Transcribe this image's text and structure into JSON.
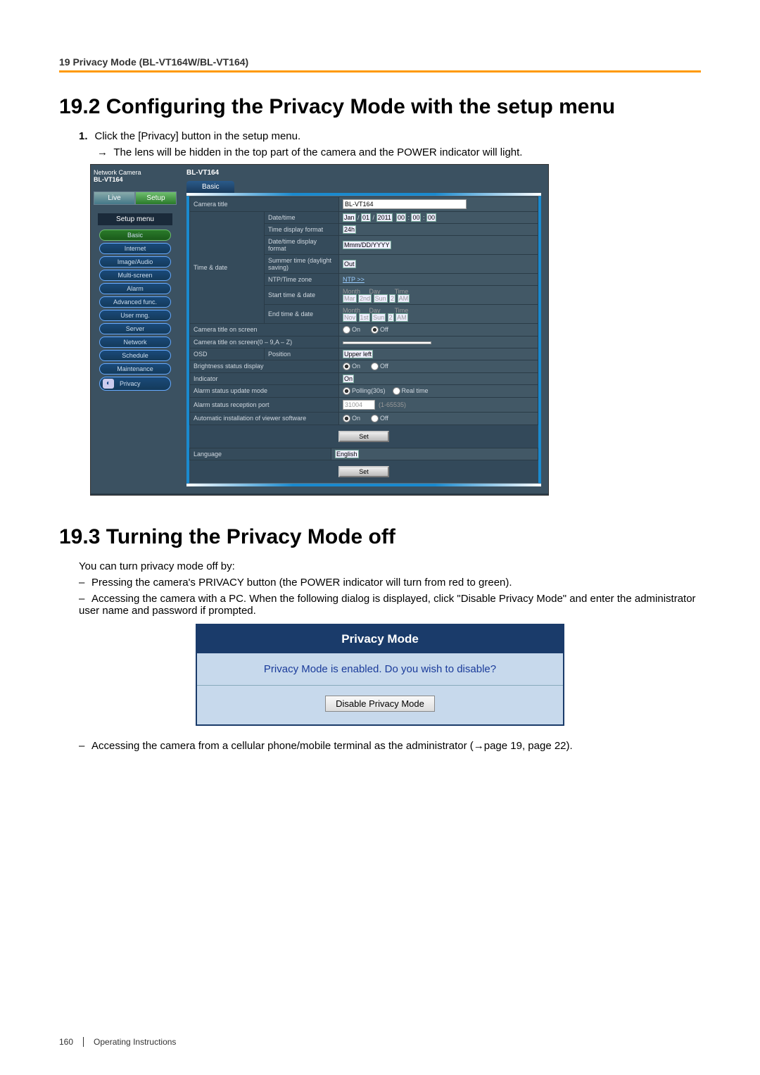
{
  "header": {
    "section": "19 Privacy Mode (BL-VT164W/BL-VT164)"
  },
  "h1_a": "19.2  Configuring the Privacy Mode with the setup menu",
  "step1_num": "1.",
  "step1_text": "Click the [Privacy] button in the setup menu.",
  "step1_sub": "The lens will be hidden in the top part of the camera and the POWER indicator will light.",
  "arrow": "→",
  "ss": {
    "top_left_a": "Network Camera",
    "top_left_b": "BL-VT164",
    "top_right": "BL-VT164",
    "tab_live": "Live",
    "tab_setup": "Setup",
    "menu_title": "Setup menu",
    "menu": [
      "Basic",
      "Internet",
      "Image/Audio",
      "Multi-screen",
      "Alarm",
      "Advanced func.",
      "User mng.",
      "Server",
      "Network",
      "Schedule",
      "Maintenance"
    ],
    "privacy": "Privacy",
    "panel_tab": "Basic",
    "rows": {
      "camera_title_lbl": "Camera title",
      "camera_title_val": "BL-VT164",
      "time_date_lbl": "Time & date",
      "dt_lbl": "Date/time",
      "dt_vals": {
        "mon": "Jan",
        "d": "01",
        "y": "2011",
        "h": "00",
        "m": "00",
        "s": "00"
      },
      "tdf_lbl": "Time display format",
      "tdf_val": "24h",
      "dtd_lbl": "Date/time display format",
      "dtd_val": "Mmm/DD/YYYY",
      "st_lbl": "Summer time (daylight saving)",
      "st_val": "Out",
      "ntp_lbl": "NTP/Time zone",
      "ntp_val": "NTP >>",
      "start_lbl": "Start time & date",
      "end_lbl": "End time & date",
      "mdt_month": "Month",
      "mdt_day": "Day",
      "mdt_time": "Time",
      "s_mon": "Mar",
      "s_wk": "2nd",
      "s_dow": "Sun",
      "s_h": "2",
      "s_ap": "AM",
      "e_mon": "Nov",
      "e_wk": "1st",
      "e_dow": "Sun",
      "e_h": "2",
      "e_ap": "AM",
      "ctos_lbl": "Camera title on screen",
      "on": "On",
      "off": "Off",
      "ctos2_lbl": "Camera title on screen(0 – 9,A – Z)",
      "osd_lbl": "OSD",
      "pos_lbl": "Position",
      "pos_val": "Upper left",
      "bsd_lbl": "Brightness status display",
      "ind_lbl": "Indicator",
      "ind_val": "On",
      "asum_lbl": "Alarm status update mode",
      "poll": "Polling(30s)",
      "rt": "Real time",
      "asrp_lbl": "Alarm status reception port",
      "asrp_val": "31004",
      "asrp_range": "(1-65535)",
      "aiv_lbl": "Automatic installation of viewer software",
      "set": "Set",
      "lang_lbl": "Language",
      "lang_val": "English"
    }
  },
  "h1_b": "19.3  Turning the Privacy Mode off",
  "p_intro": "You can turn privacy mode off by:",
  "b1": "Pressing the camera's PRIVACY button (the POWER indicator will turn from red to green).",
  "b2": "Accessing the camera with a PC. When the following dialog is displayed, click \"Disable Privacy Mode\" and enter the administrator user name and password if prompted.",
  "dlg": {
    "title": "Privacy Mode",
    "msg": "Privacy Mode is enabled. Do you wish to disable?",
    "btn": "Disable Privacy Mode"
  },
  "b3a": "Accessing the camera from a cellular phone/mobile terminal as the administrator (",
  "b3b": "page 19, page 22).",
  "footer": {
    "pn": "160",
    "label": "Operating Instructions"
  }
}
